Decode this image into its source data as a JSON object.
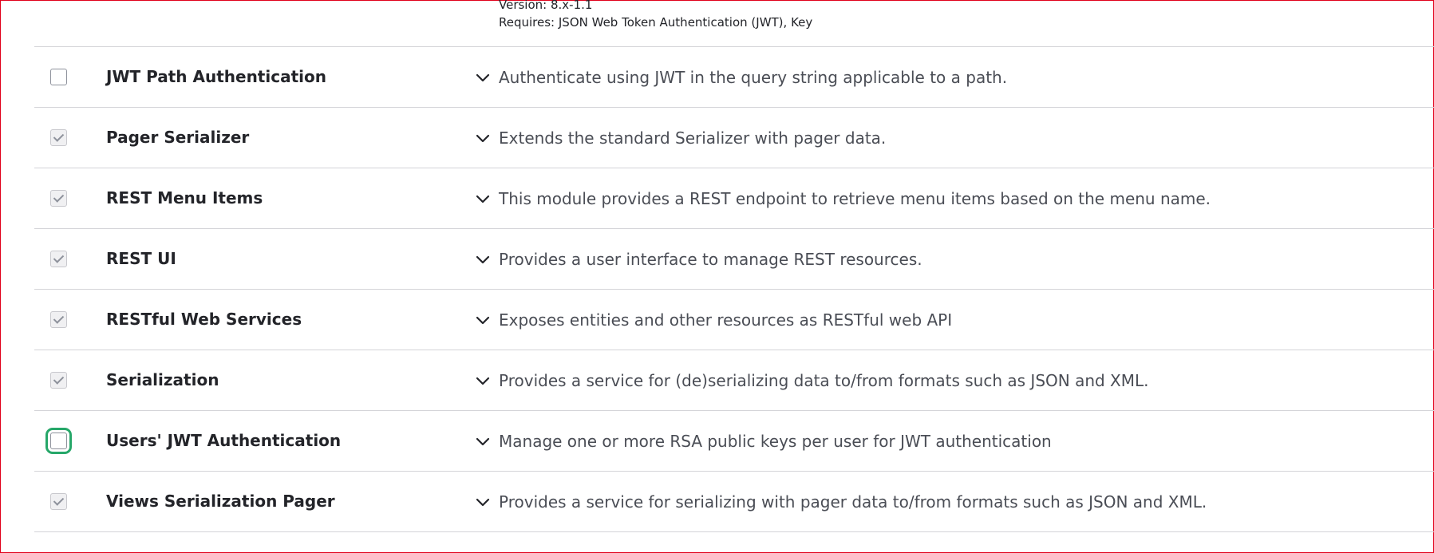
{
  "top_meta": {
    "version": "Version: 8.x-1.1",
    "requires": "Requires: JSON Web Token Authentication (JWT), Key"
  },
  "modules": [
    {
      "name": "JWT Path Authentication",
      "description": "Authenticate using JWT in the query string applicable to a path.",
      "checked": false,
      "focused": false
    },
    {
      "name": "Pager Serializer",
      "description": "Extends the standard Serializer with pager data.",
      "checked": true,
      "focused": false
    },
    {
      "name": "REST Menu Items",
      "description": "This module provides a REST endpoint to retrieve menu items based on the menu name.",
      "checked": true,
      "focused": false
    },
    {
      "name": "REST UI",
      "description": "Provides a user interface to manage REST resources.",
      "checked": true,
      "focused": false
    },
    {
      "name": "RESTful Web Services",
      "description": "Exposes entities and other resources as RESTful web API",
      "checked": true,
      "focused": false
    },
    {
      "name": "Serialization",
      "description": "Provides a service for (de)serializing data to/from formats such as JSON and XML.",
      "checked": true,
      "focused": false
    },
    {
      "name": "Users' JWT Authentication",
      "description": "Manage one or more RSA public keys per user for JWT authentication",
      "checked": false,
      "focused": true
    },
    {
      "name": "Views Serialization Pager",
      "description": "Provides a service for serializing with pager data to/from formats such as JSON and XML.",
      "checked": true,
      "focused": false
    }
  ],
  "icons": {
    "expand": "chevron-down-icon",
    "checked": "checkmark-icon"
  },
  "colors": {
    "focus_ring": "#26a769",
    "frame_border": "#e0001a",
    "divider": "#d4d4d8"
  }
}
